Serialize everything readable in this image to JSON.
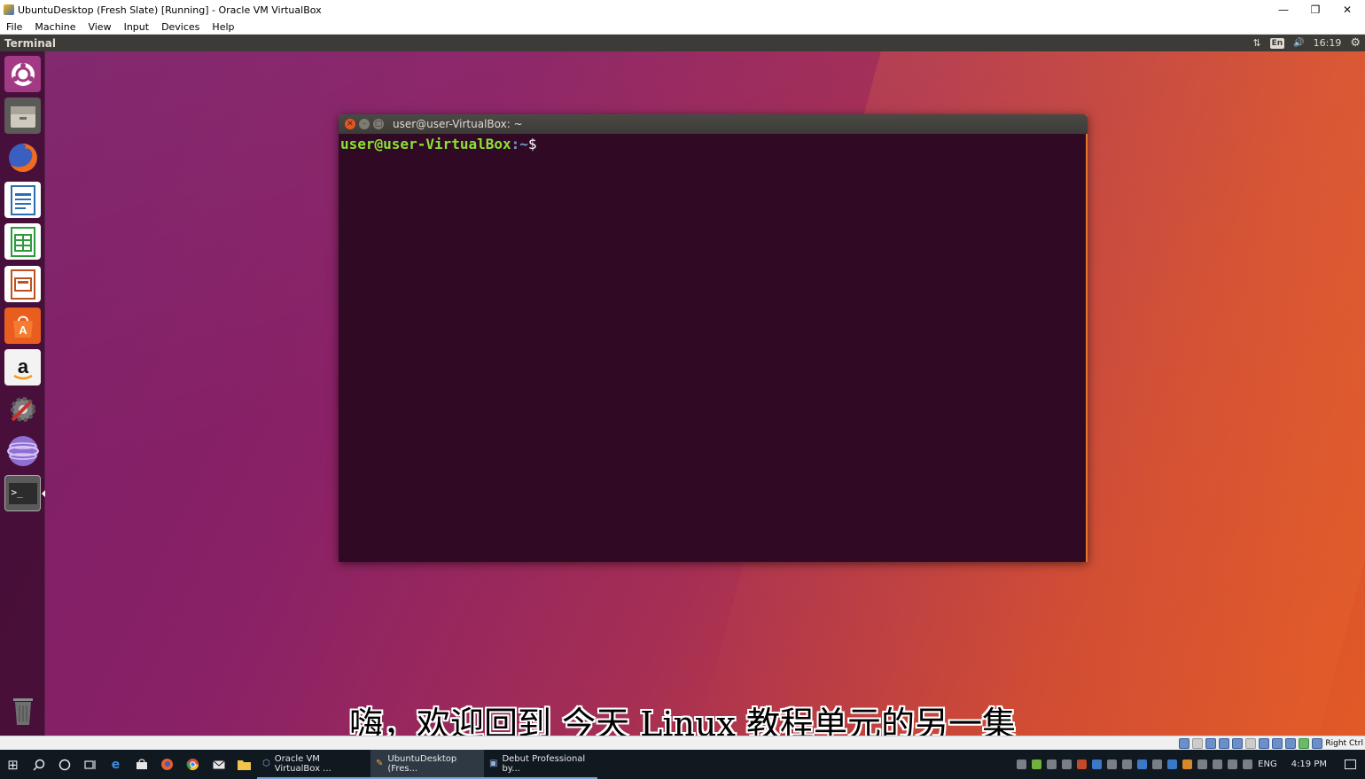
{
  "host_window": {
    "title": "UbuntuDesktop (Fresh Slate) [Running] - Oracle VM VirtualBox",
    "controls": {
      "minimize": "—",
      "restore": "❐",
      "close": "✕"
    },
    "menu": [
      "File",
      "Machine",
      "View",
      "Input",
      "Devices",
      "Help"
    ]
  },
  "ubuntu_panel": {
    "app_name": "Terminal",
    "keyboard_layout": "En",
    "clock": "16:19",
    "network_glyph": "⇅",
    "volume_glyph": "🔊",
    "settings_glyph": "⚙"
  },
  "launcher": {
    "items": [
      {
        "name": "ubuntu-dash-icon",
        "label": "Search your computer"
      },
      {
        "name": "files-icon",
        "label": "Files"
      },
      {
        "name": "firefox-icon",
        "label": "Firefox Web Browser"
      },
      {
        "name": "writer-icon",
        "label": "LibreOffice Writer"
      },
      {
        "name": "calc-icon",
        "label": "LibreOffice Calc"
      },
      {
        "name": "impress-icon",
        "label": "LibreOffice Impress"
      },
      {
        "name": "software-icon",
        "label": "Ubuntu Software"
      },
      {
        "name": "amazon-icon",
        "label": "Amazon"
      },
      {
        "name": "system-settings-icon",
        "label": "System Settings"
      },
      {
        "name": "disc-icon",
        "label": "Disc"
      },
      {
        "name": "terminal-icon",
        "label": "Terminal"
      },
      {
        "name": "trash-icon",
        "label": "Trash"
      }
    ],
    "amazon_letter": "a",
    "terminal_glyph": ">_"
  },
  "terminal": {
    "title": "user@user-VirtualBox: ~",
    "prompt_user": "user@user-VirtualBox",
    "prompt_path": ":~",
    "prompt_symbol": "$",
    "buttons": {
      "close": "✕",
      "minimize": "–",
      "maximize": "□"
    }
  },
  "subtitle": "嗨，欢迎回到 今天 Linux 教程单元的另一集",
  "vbox_status": {
    "host_key": "Right Ctrl"
  },
  "taskbar": {
    "start_glyph": "⊞",
    "apps": [
      {
        "label": "Oracle VM VirtualBox ...",
        "active": false
      },
      {
        "label": "UbuntuDesktop (Fres...",
        "active": true
      },
      {
        "label": "Debut Professional by...",
        "active": false
      }
    ],
    "tray": {
      "language": "ENG",
      "time": "4:19 PM"
    }
  },
  "colors": {
    "terminal_bg": "#300a24",
    "prompt_user": "#8ae234",
    "prompt_path": "#729fcf",
    "panel": "#3c3b37"
  }
}
